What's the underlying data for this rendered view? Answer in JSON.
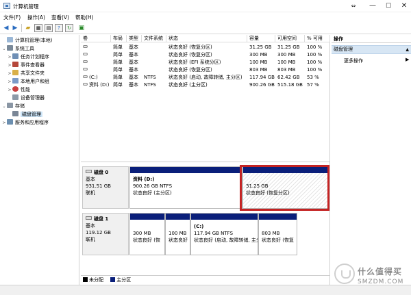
{
  "window": {
    "title": "计算机管理",
    "controls": {
      "link": "⇔",
      "minimize": "—",
      "maximize": "☐",
      "close": "✕"
    }
  },
  "menu": [
    "文件(F)",
    "操作(A)",
    "查看(V)",
    "帮助(H)"
  ],
  "toolbar_icons": [
    "back-arrow-icon",
    "forward-arrow-icon",
    "folder-up-icon",
    "console-tree-icon",
    "properties-icon",
    "help-icon",
    "refresh-icon",
    "export-icon"
  ],
  "tree": [
    {
      "label": "计算机管理(本地)",
      "icon": "computer-icon",
      "level": 0,
      "expander": ""
    },
    {
      "label": "系统工具",
      "icon": "tools-icon",
      "level": 1,
      "expander": "⌄"
    },
    {
      "label": "任务计划程序",
      "icon": "clock-icon",
      "level": 2,
      "expander": ">"
    },
    {
      "label": "事件查看器",
      "icon": "event-viewer-icon",
      "level": 2,
      "expander": ">"
    },
    {
      "label": "共享文件夹",
      "icon": "folder-icon",
      "level": 2,
      "expander": ">"
    },
    {
      "label": "本地用户和组",
      "icon": "users-icon",
      "level": 2,
      "expander": ">"
    },
    {
      "label": "性能",
      "icon": "performance-icon",
      "level": 2,
      "expander": ">"
    },
    {
      "label": "设备管理器",
      "icon": "device-manager-icon",
      "level": 2,
      "expander": ""
    },
    {
      "label": "存储",
      "icon": "storage-icon",
      "level": 1,
      "expander": "⌄"
    },
    {
      "label": "磁盘管理",
      "icon": "disk-management-icon",
      "level": 2,
      "expander": "",
      "selected": true
    },
    {
      "label": "服务和应用程序",
      "icon": "services-icon",
      "level": 1,
      "expander": ">"
    }
  ],
  "volume_table": {
    "headers": [
      "卷",
      "布局",
      "类型",
      "文件系统",
      "状态",
      "容量",
      "可用空间",
      "% 可用"
    ],
    "rows": [
      [
        "",
        "简单",
        "基本",
        "",
        "状态良好 (恢复分区)",
        "31.25 GB",
        "31.25 GB",
        "100 %"
      ],
      [
        "",
        "简单",
        "基本",
        "",
        "状态良好 (恢复分区)",
        "300 MB",
        "300 MB",
        "100 %"
      ],
      [
        "",
        "简单",
        "基本",
        "",
        "状态良好 (EFI 系统分区)",
        "100 MB",
        "100 MB",
        "100 %"
      ],
      [
        "",
        "简单",
        "基本",
        "",
        "状态良好 (恢复分区)",
        "803 MB",
        "803 MB",
        "100 %"
      ],
      [
        "(C:)",
        "简单",
        "基本",
        "NTFS",
        "状态良好 (启动, 故障转储, 主分区)",
        "117.94 GB",
        "62.42 GB",
        "53 %"
      ],
      [
        "资料 (D:)",
        "简单",
        "基本",
        "NTFS",
        "状态良好 (主分区)",
        "900.26 GB",
        "515.18 GB",
        "57 %"
      ]
    ]
  },
  "disks": [
    {
      "name": "磁盘 0",
      "type": "基本",
      "size": "931.51 GB",
      "status": "联机",
      "partitions": [
        {
          "title": "资料  (D:)",
          "line1": "900.26 GB NTFS",
          "line2": "状态良好 (主分区)",
          "style": "primary"
        },
        {
          "title": "",
          "line1": "31.25 GB",
          "line2": "状态良好 (恢复分区)",
          "style": "hatched-highlighted"
        }
      ]
    },
    {
      "name": "磁盘 1",
      "type": "基本",
      "size": "119.12 GB",
      "status": "联机",
      "partitions": [
        {
          "title": "",
          "line1": "300 MB",
          "line2": "状态良好 (恢",
          "style": "primary"
        },
        {
          "title": "",
          "line1": "100 MB",
          "line2": "状态良好",
          "style": "primary"
        },
        {
          "title": "(C:)",
          "line1": "117.94 GB NTFS",
          "line2": "状态良好 (启动, 故障转储, 主分",
          "style": "primary"
        },
        {
          "title": "",
          "line1": "803 MB",
          "line2": "状态良好 (恢复",
          "style": "primary"
        }
      ]
    }
  ],
  "legend": [
    {
      "label": "未分配",
      "color": "#000000"
    },
    {
      "label": "主分区",
      "color": "#0a1f7a"
    }
  ],
  "actions": {
    "header": "操作",
    "selected": "磁盘管理",
    "more": "更多操作"
  },
  "watermark": {
    "line1": "什么值得买",
    "line2": "SMZDM.COM"
  },
  "colors": {
    "partition_bar": "#0a1f7a",
    "highlight_border": "#c42323",
    "selection": "#cce4f7"
  }
}
